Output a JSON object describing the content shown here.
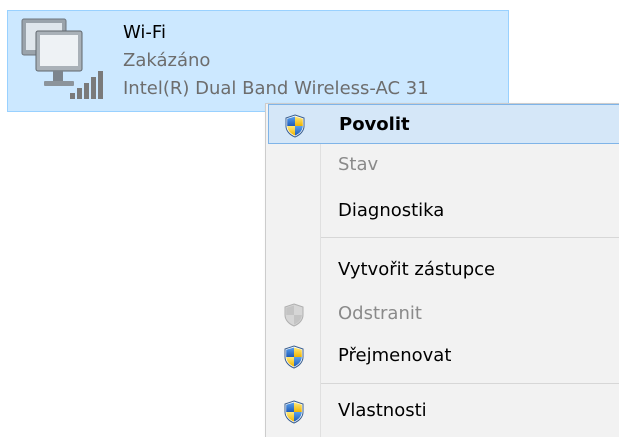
{
  "adapter": {
    "name": "Wi-Fi",
    "status": "Zakázáno",
    "device": "Intel(R) Dual Band Wireless-AC 31",
    "icon": "network-computers-icon"
  },
  "context_menu": {
    "items": [
      {
        "label": "Povolit",
        "bold": true,
        "disabled": false,
        "icon": "uac-shield-icon",
        "highlighted": true
      },
      {
        "label": "Stav",
        "bold": false,
        "disabled": true,
        "icon": "",
        "highlighted": false
      },
      {
        "label": "Diagnostika",
        "bold": false,
        "disabled": false,
        "icon": "",
        "highlighted": false
      },
      {
        "label": "Vytvořit zástupce",
        "bold": false,
        "disabled": false,
        "icon": "",
        "highlighted": false
      },
      {
        "label": "Odstranit",
        "bold": false,
        "disabled": true,
        "icon": "uac-shield-gray-icon",
        "highlighted": false
      },
      {
        "label": "Přejmenovat",
        "bold": false,
        "disabled": false,
        "icon": "uac-shield-icon",
        "highlighted": false
      },
      {
        "label": "Vlastnosti",
        "bold": false,
        "disabled": false,
        "icon": "uac-shield-icon",
        "highlighted": false
      }
    ]
  },
  "colors": {
    "tile_bg": "#cce8ff",
    "tile_border": "#99d1ff",
    "menu_bg": "#f2f2f2",
    "highlight_bg": "#d5e7f8",
    "highlight_border": "#7fb4e8",
    "disabled_text": "#8a8a8a"
  }
}
